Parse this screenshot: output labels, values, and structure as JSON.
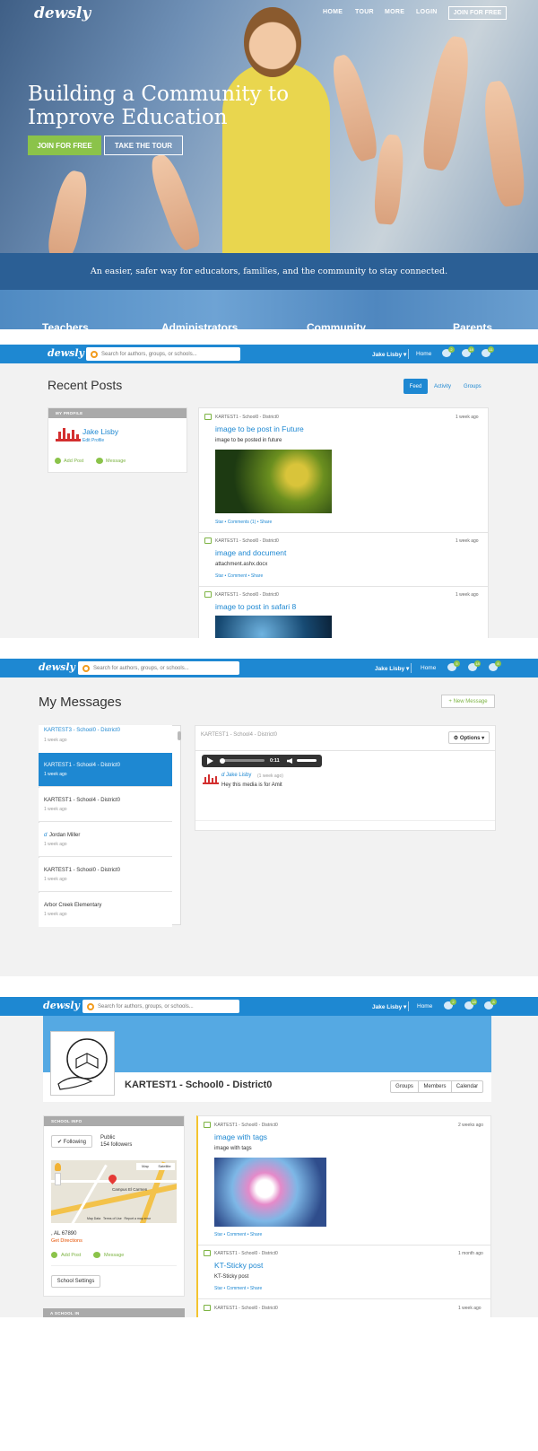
{
  "hero": {
    "logo": "dewsly",
    "nav": [
      "HOME",
      "TOUR",
      "MORE",
      "LOGIN"
    ],
    "join_nav": "JOIN FOR FREE",
    "headline": "Building a Community to Improve Education",
    "join_button": "JOIN FOR FREE",
    "tour_button": "TAKE THE TOUR",
    "tagline": "An easier, safer way for educators, families, and the community to stay connected.",
    "audiences": [
      "Teachers",
      "Administrators",
      "Community",
      "Parents"
    ]
  },
  "appbar": {
    "logo": "dewsly",
    "search_placeholder": "Search for authors, groups, or schools...",
    "user": "Jake Lisby ▾",
    "home": "Home",
    "badges": [
      "2",
      "18",
      "11"
    ],
    "badges_2": [
      "5",
      "18",
      "8"
    ],
    "badges_3": [
      "2",
      "18",
      "8"
    ]
  },
  "recent": {
    "title": "Recent Posts",
    "tabs": [
      "Feed",
      "Activity",
      "Groups"
    ],
    "profile_header": "MY PROFILE",
    "profile_name": "Jake Lisby",
    "edit_profile": "Edit Profile",
    "add_post": "Add Post",
    "message": "Message",
    "posts": [
      {
        "meta": "KARTEST1 - School0 - District0",
        "time": "1 week ago",
        "title": "image to be post in Future",
        "body": "image to be posted in future",
        "links": "Star • Comments (1) • Share"
      },
      {
        "meta": "KARTEST1 - School0 - District0",
        "time": "1 week ago",
        "title": "image and document",
        "body": "attachment.ashx.docx",
        "links": "Star • Comment • Share"
      },
      {
        "meta": "KARTEST1 - School0 - District0",
        "time": "1 week ago",
        "title": "image to post in safari 8"
      }
    ]
  },
  "messages": {
    "title": "My Messages",
    "new_message": "+ New Message",
    "threads": [
      {
        "name": "KARTEST3 - School0 - District0",
        "time": "1 week ago"
      },
      {
        "name": "KARTEST1 - School4 - District0",
        "time": "1 week ago"
      },
      {
        "name": "KARTEST1 - School4 - District0",
        "time": "1 week ago"
      },
      {
        "name": "Jordan Miller",
        "time": "1 week ago"
      },
      {
        "name": "KARTEST1 - School0 - District0",
        "time": "1 week ago"
      },
      {
        "name": "Arbor Creek Elementary",
        "time": "1 week ago"
      }
    ],
    "conversation_header": "KARTEST1 - School4 - District0",
    "options": "⚙ Options ▾",
    "audio_time": "0:11",
    "sender": "Jake Lisby",
    "sent_time": "(1 week ago)",
    "text": "Hey this media is for Amit"
  },
  "school": {
    "name": "KARTEST1 - School0 - District0",
    "tabs": [
      "Groups",
      "Members",
      "Calendar"
    ],
    "info_header": "SCHOOL INFO",
    "following": "✔ Following",
    "visibility": "Public",
    "followers": "154 followers",
    "map_buttons": [
      "Map",
      "Satellite"
    ],
    "map_label": "Campus El Carmen",
    "map_footer": "Map Data   Terms of Use   Report a map error",
    "address": ", AL 67890",
    "directions": "Get Directions",
    "add_post": "Add Post",
    "message": "Message",
    "settings": "School Settings",
    "a_school_in": "A SCHOOL IN",
    "posts": [
      {
        "meta": "KARTEST1 - School0 - District0",
        "time": "2 weeks ago",
        "title": "image with tags",
        "body": "image with tags",
        "links": "Star • Comment • Share"
      },
      {
        "meta": "KARTEST1 - School0 - District0",
        "time": "1 month ago",
        "title": "KT-Sticky post",
        "body": "KT-Sticky post",
        "links": "Star • Comment • Share"
      },
      {
        "meta": "KARTEST1 - School0 - District0",
        "time": "1 week ago"
      }
    ]
  },
  "colors": {
    "brand": "#1e88d2",
    "accent": "#8bc34a",
    "band": "#2b5f95"
  }
}
